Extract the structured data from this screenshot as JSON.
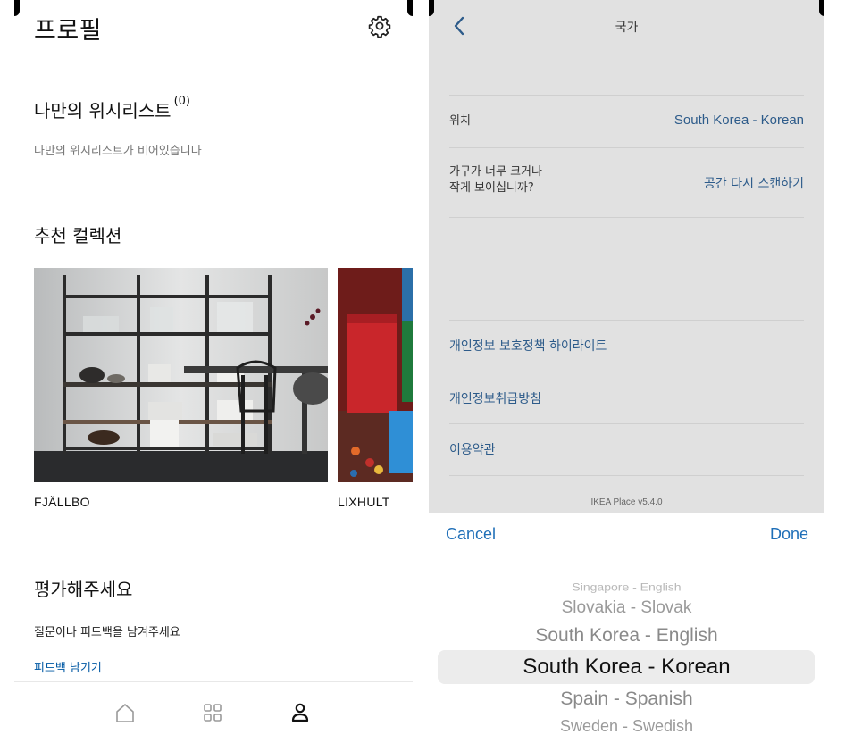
{
  "left": {
    "title": "프로필",
    "wishlist": {
      "title": "나만의 위시리스트",
      "count": "(0)",
      "empty_text": "나만의 위시리스트가 비어있습니다"
    },
    "recommended": {
      "title": "추천 컬렉션",
      "collections": [
        {
          "name": "FJÄLLBO"
        },
        {
          "name": "LIXHULT"
        }
      ]
    },
    "rate": {
      "title": "평가해주세요",
      "description": "질문이나 피드백을 남겨주세요",
      "link": "피드백 남기기"
    },
    "tabs": [
      "home-icon",
      "grid-icon",
      "person-icon"
    ],
    "colors": {
      "link": "#0058a3",
      "active_tab": "#111111",
      "inactive_tab": "#9a9a9a"
    }
  },
  "right": {
    "nav_title": "국가",
    "location": {
      "label": "위치",
      "value": "South Korea - Korean"
    },
    "scale": {
      "label_line1": "가구가 너무 크거나",
      "label_line2": "작게 보이십니까?",
      "value": "공간 다시 스캔하기"
    },
    "links": [
      "개인정보 보호정책 하이라이트",
      "개인정보취급방침",
      "이용약관"
    ],
    "version": "IKEA Place v5.4.0",
    "toolbar": {
      "cancel": "Cancel",
      "done": "Done"
    },
    "picker": {
      "items": [
        "Singapore - English",
        "Slovakia - Slovak",
        "South Korea - English",
        "South Korea - Korean",
        "Spain - Spanish",
        "Sweden - Swedish"
      ],
      "selected": "South Korea - Korean"
    },
    "colors": {
      "overlay": "#e1e1e1",
      "link": "#2d5b8a",
      "toolbar": "#1f6fb8"
    }
  }
}
